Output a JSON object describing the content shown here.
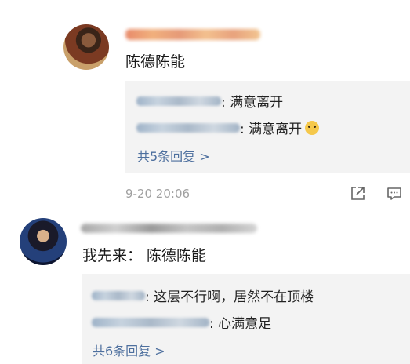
{
  "comment1": {
    "text": "陈德陈能",
    "replies": [
      {
        "text": ": 满意离开",
        "emoji": "cat-face-emoji"
      },
      {
        "text": ": 满意离开"
      }
    ],
    "more": "共5条回复 >",
    "time": "9-20 20:06"
  },
  "comment2": {
    "text": "我先来： 陈德陈能",
    "replies": [
      {
        "text": ": 这层不行啊，居然不在顶楼"
      },
      {
        "text": ": 心满意足"
      }
    ],
    "more": "共6条回复 >"
  },
  "icons": [
    "share-icon",
    "comment-icon"
  ],
  "colors": {
    "link": "#4d6f9e",
    "reply_bg": "#f3f3f3",
    "time": "#a0a0a0"
  }
}
